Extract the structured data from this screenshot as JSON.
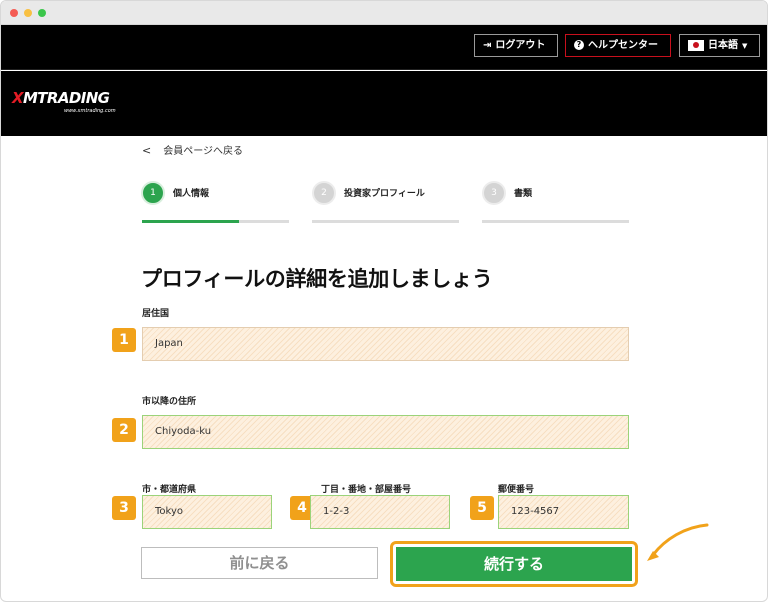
{
  "topbar": {
    "logout": "ログアウト",
    "help": "ヘルプセンター",
    "language": "日本語"
  },
  "brand": {
    "x": "X",
    "name": "MTRADING",
    "url": "www.xmtrading.com"
  },
  "back_link": "会員ページへ戻る",
  "steps": [
    {
      "number": "1",
      "label": "個人情報",
      "status": "active"
    },
    {
      "number": "2",
      "label": "投資家プロフィール",
      "status": "inactive"
    },
    {
      "number": "3",
      "label": "書類",
      "status": "inactive"
    }
  ],
  "progress": {
    "step1_fraction": 0.66
  },
  "page_title": "プロフィールの詳細を追加しましょう",
  "form": {
    "country_label": "居住国",
    "country_value": "Japan",
    "address_label": "市以降の住所",
    "address_value": "Chiyoda-ku",
    "prefecture_label": "市・都道府県",
    "prefecture_value": "Tokyo",
    "street_label": "丁目・番地・部屋番号",
    "street_value": "1-2-3",
    "postal_label": "郵便番号",
    "postal_value": "123-4567"
  },
  "badges": [
    "1",
    "2",
    "3",
    "4",
    "5"
  ],
  "buttons": {
    "back": "前に戻る",
    "next": "続行する"
  },
  "colors": {
    "accent_green": "#2ca44e",
    "highlight_orange": "#f1a21a",
    "brand_red": "#e31c25"
  }
}
